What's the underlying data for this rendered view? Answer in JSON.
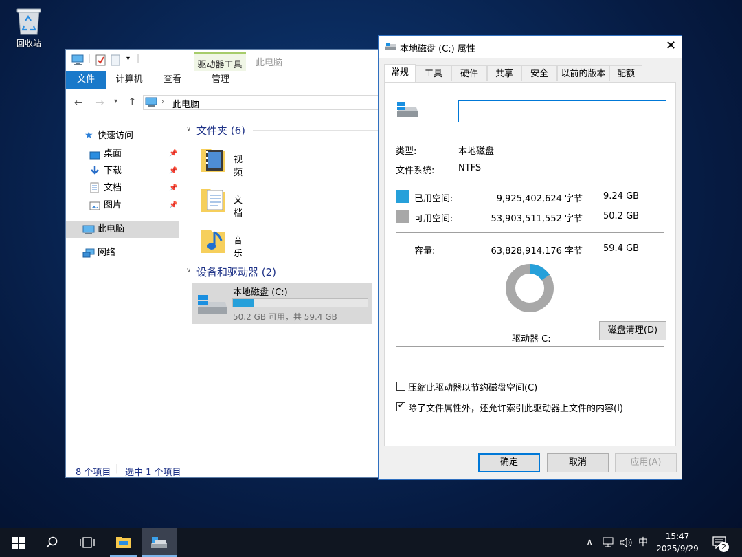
{
  "desktop": {
    "recycle_bin_label": "回收站"
  },
  "explorer": {
    "qat_separator": "|",
    "ribbon": {
      "context_group_label": "驱动器工具",
      "title": "此电脑",
      "tabs": [
        "文件",
        "计算机",
        "查看",
        "管理"
      ]
    },
    "address": {
      "path": "此电脑"
    },
    "nav": {
      "quick_access": "快速访问",
      "pinned": [
        "桌面",
        "下载",
        "文档",
        "图片"
      ],
      "this_pc": "此电脑",
      "network": "网络"
    },
    "folders_header": "文件夹 (6)",
    "folders": [
      "视频",
      "文档",
      "音乐"
    ],
    "devices_header": "设备和驱动器 (2)",
    "drive": {
      "name": "本地磁盘 (C:)",
      "free_text": "50.2 GB 可用，共 59.4 GB",
      "used_fraction": 0.155
    },
    "status": {
      "items": "8 个项目",
      "selected": "选中 1 个项目"
    }
  },
  "dialog": {
    "title": "本地磁盘 (C:) 属性",
    "tabs": [
      "常规",
      "工具",
      "硬件",
      "共享",
      "安全",
      "以前的版本",
      "配额"
    ],
    "active_tab": "常规",
    "name_value": "",
    "type_label": "类型:",
    "type_value": "本地磁盘",
    "fs_label": "文件系统:",
    "fs_value": "NTFS",
    "used": {
      "label": "已用空间:",
      "bytes": "9,925,402,624 字节",
      "size": "9.24 GB",
      "color": "#26a0da"
    },
    "free": {
      "label": "可用空间:",
      "bytes": "53,903,511,552 字节",
      "size": "50.2 GB",
      "color": "#a8a8a8"
    },
    "capacity": {
      "label": "容量:",
      "bytes": "63,828,914,176 字节",
      "size": "59.4 GB"
    },
    "used_fraction": 0.155,
    "drive_label": "驱动器 C:",
    "cleanup_button": "磁盘清理(D)",
    "compress_label": "压缩此驱动器以节约磁盘空间(C)",
    "compress_checked": false,
    "index_label": "除了文件属性外，还允许索引此驱动器上文件的内容(I)",
    "index_checked": true,
    "buttons": {
      "ok": "确定",
      "cancel": "取消",
      "apply": "应用(A)"
    }
  },
  "taskbar": {
    "time": "15:47",
    "date": "2025/9/29",
    "ime": "中",
    "notification_count": "2"
  }
}
